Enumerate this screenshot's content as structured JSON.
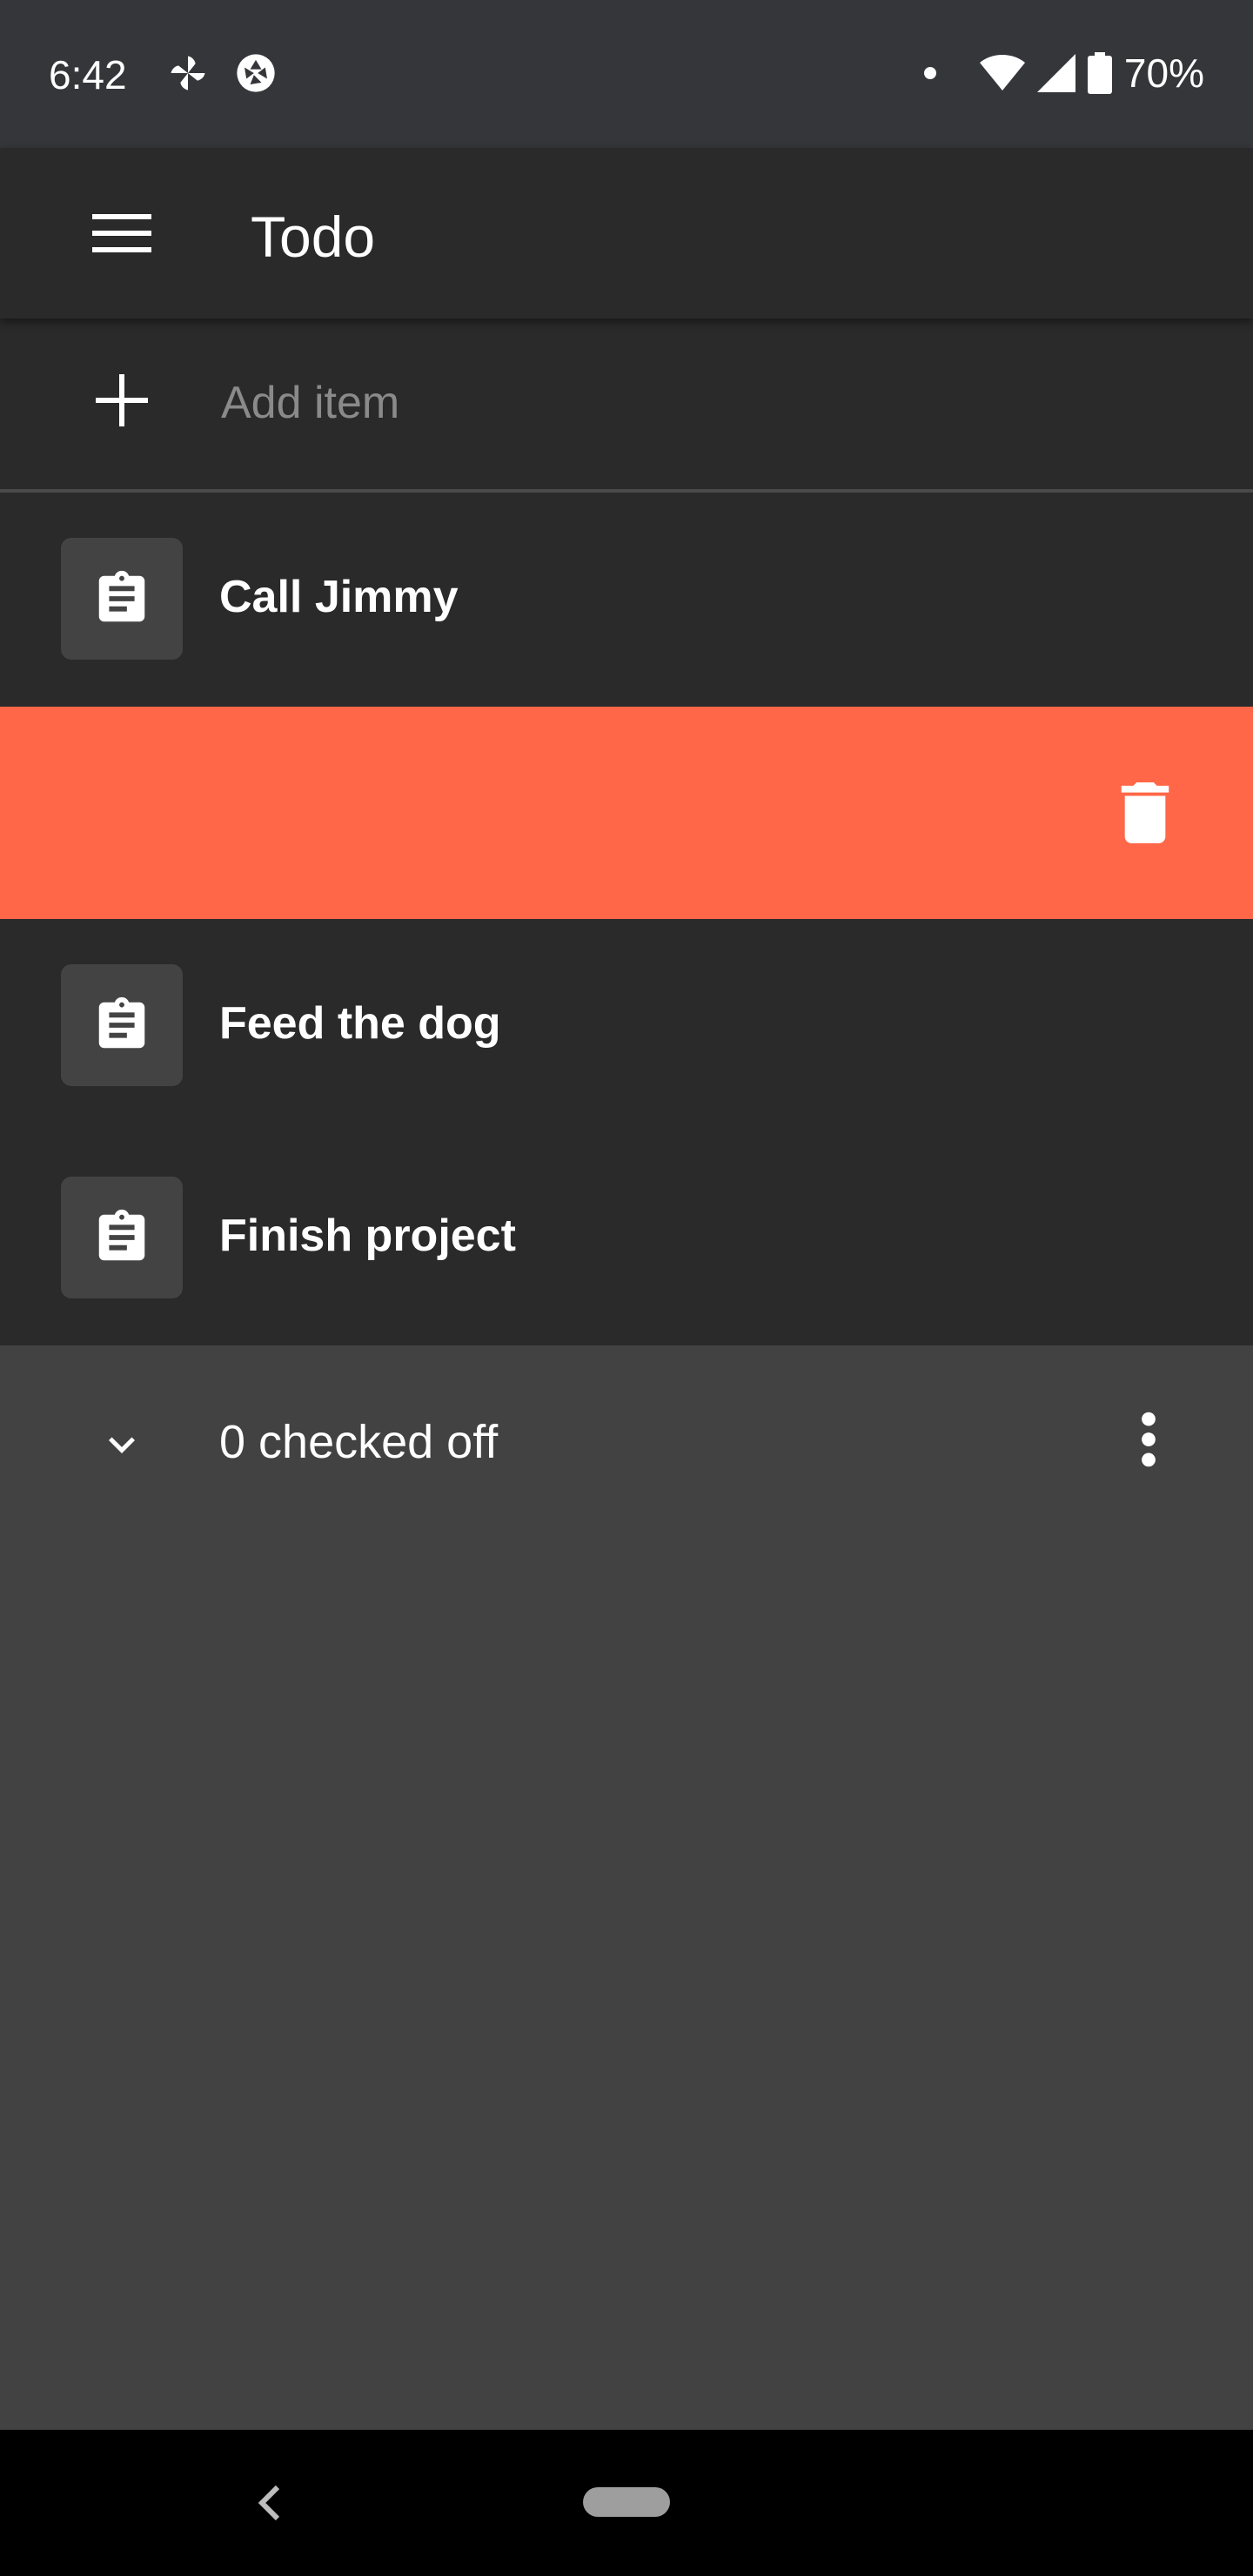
{
  "status_bar": {
    "time": "6:42",
    "notification_icons": [
      "pinwheel-icon",
      "aperture-icon"
    ],
    "battery_percent": "70%",
    "system_icons": [
      "dot-icon",
      "wifi-icon",
      "signal-icon",
      "battery-icon"
    ]
  },
  "app_bar": {
    "title": "Todo",
    "menu_icon": "menu-icon"
  },
  "add_item": {
    "placeholder": "Add item",
    "icon": "plus-icon"
  },
  "items": [
    {
      "label": "Call Jimmy",
      "icon": "clipboard-icon"
    },
    {
      "label": "Feed the dog",
      "icon": "clipboard-icon"
    },
    {
      "label": "Finish project",
      "icon": "clipboard-icon"
    }
  ],
  "swipe_action": {
    "icon": "trash-icon",
    "color": "#ff6748"
  },
  "checked_section": {
    "label": "0 checked off",
    "expand_icon": "chevron-down-icon",
    "more_icon": "more-vert-icon"
  },
  "colors": {
    "app_bar": "#2a2a2a",
    "list_background": "#2a2a2a",
    "page_background": "#424242",
    "status_bar": "#35363a",
    "delete_accent": "#ff6748"
  }
}
